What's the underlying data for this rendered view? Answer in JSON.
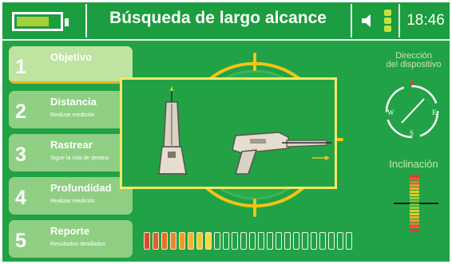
{
  "header": {
    "title": "Búsqueda de largo alcance",
    "time": "18:46",
    "battery_level": 0.75,
    "signal_level": 1.0
  },
  "steps": [
    {
      "number": "1",
      "label": "Objetivo",
      "sub": "",
      "active": true
    },
    {
      "number": "2",
      "label": "Distancia",
      "sub": "Realizar medición",
      "active": false
    },
    {
      "number": "3",
      "label": "Rastrear",
      "sub": "Sigue la ruta de destino",
      "active": false
    },
    {
      "number": "4",
      "label": "Profundidad",
      "sub": "Realizar medición",
      "active": false
    },
    {
      "number": "5",
      "label": "Reporte",
      "sub": "Resultados detallados",
      "active": false
    }
  ],
  "direction": {
    "label_line1": "Dirección",
    "label_line2": "del dispositivo",
    "compass_w": "W",
    "compass_e": "E",
    "compass_s": "S"
  },
  "inclination": {
    "label": "Inclinación"
  },
  "signal_strength": {
    "filled_segments": 8,
    "total_segments": 24
  },
  "colors": {
    "background": "#21a246",
    "accent_yellow": "#f4c316",
    "step_active": "#bfe3a0",
    "step_inactive": "#8fcf83"
  }
}
